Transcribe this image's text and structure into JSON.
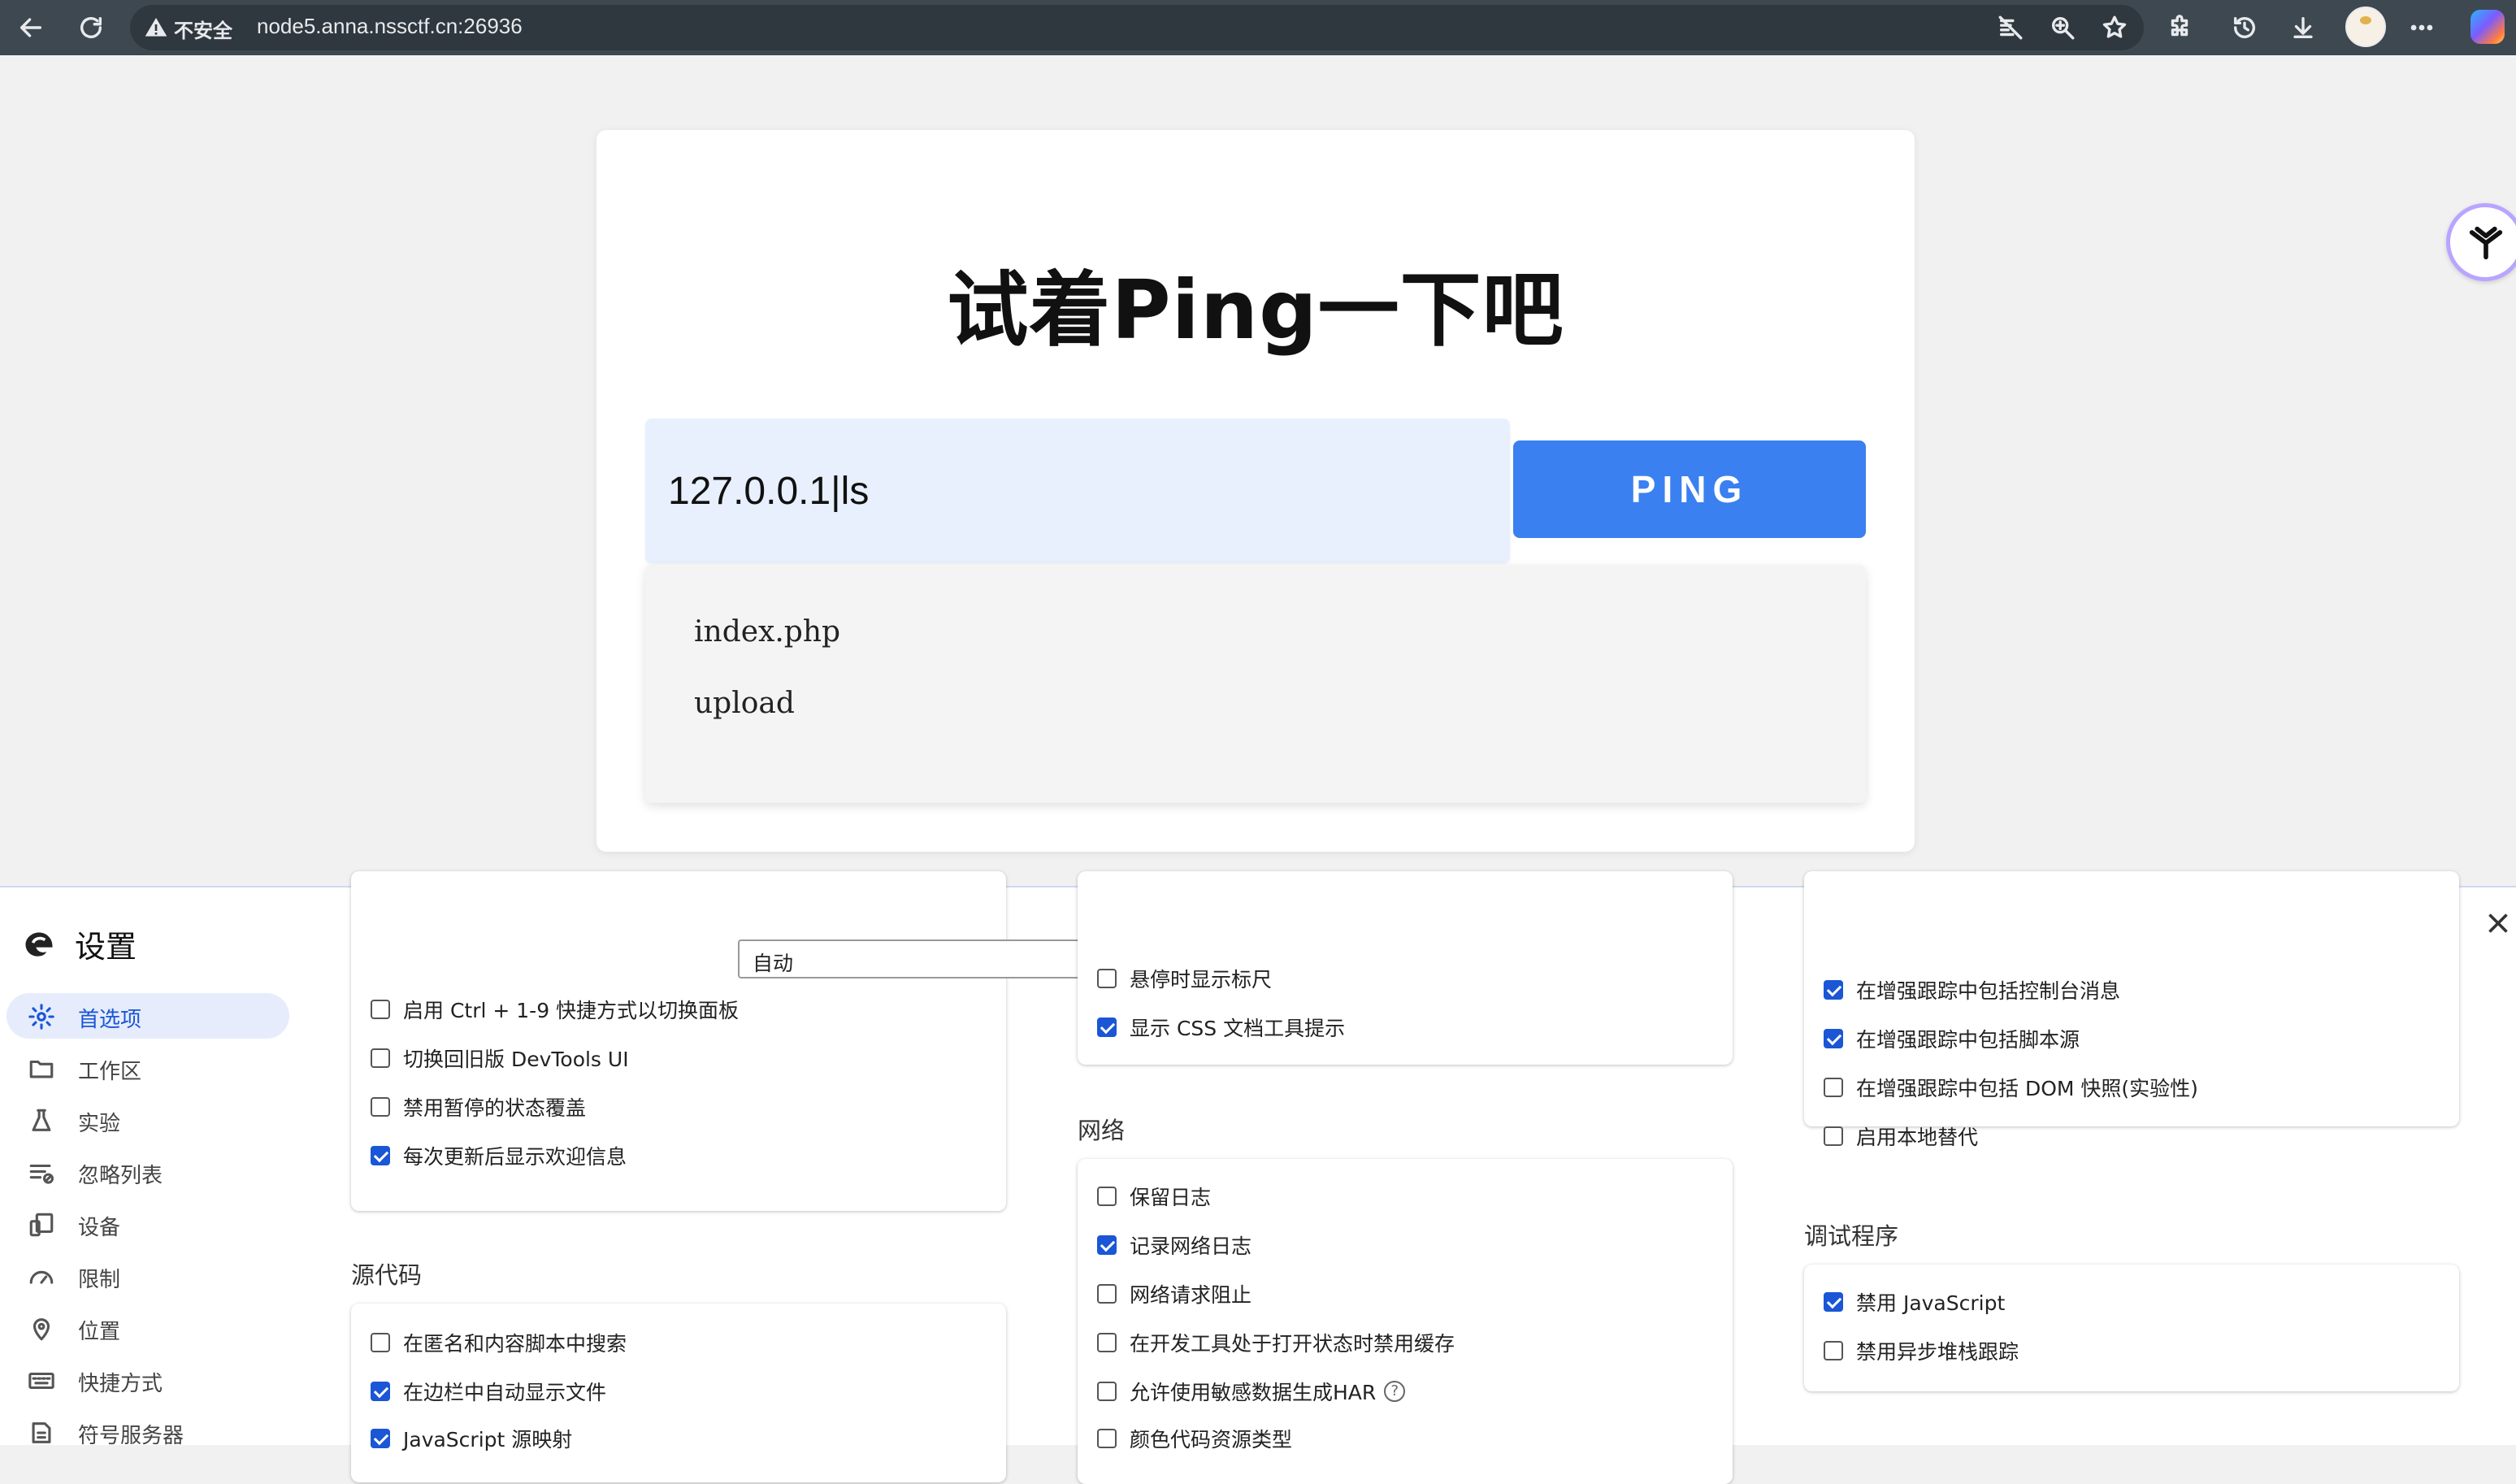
{
  "browser": {
    "security_label": "不安全",
    "url": "node5.anna.nssctf.cn:26936",
    "icons": [
      "back-icon",
      "reload-icon",
      "warning-icon",
      "reading-mode-off-icon",
      "zoom-icon",
      "favorite-star-icon",
      "extensions-icon",
      "history-icon",
      "download-icon",
      "profile-avatar",
      "more-icon",
      "copilot-icon"
    ]
  },
  "page": {
    "title": "试着Ping一下吧",
    "input_value": "127.0.0.1|ls",
    "button_label": "PING",
    "results": [
      "index.php",
      "upload"
    ]
  },
  "devtools": {
    "title": "设置",
    "nav": [
      {
        "label": "首选项",
        "icon": "gear-icon",
        "active": true
      },
      {
        "label": "工作区",
        "icon": "folder-icon",
        "active": false
      },
      {
        "label": "实验",
        "icon": "flask-icon",
        "active": false
      },
      {
        "label": "忽略列表",
        "icon": "ignore-list-icon",
        "active": false
      },
      {
        "label": "设备",
        "icon": "devices-icon",
        "active": false
      },
      {
        "label": "限制",
        "icon": "throttle-icon",
        "active": false
      },
      {
        "label": "位置",
        "icon": "location-pin-icon",
        "active": false
      },
      {
        "label": "快捷方式",
        "icon": "keyboard-icon",
        "active": false
      },
      {
        "label": "符号服务器",
        "icon": "symbol-server-icon",
        "active": false
      }
    ],
    "col1": {
      "select_value": "自动",
      "options": [
        {
          "label": "启用 Ctrl + 1-9 快捷方式以切换面板",
          "checked": false
        },
        {
          "label": "切换回旧版 DevTools UI",
          "checked": false
        },
        {
          "label": "禁用暂停的状态覆盖",
          "checked": false
        },
        {
          "label": "每次更新后显示欢迎信息",
          "checked": true
        }
      ],
      "sources_heading": "源代码",
      "sources_options": [
        {
          "label": "在匿名和内容脚本中搜索",
          "checked": false
        },
        {
          "label": "在边栏中自动显示文件",
          "checked": true
        },
        {
          "label": "JavaScript 源映射",
          "checked": true
        }
      ]
    },
    "col2": {
      "options": [
        {
          "label": "悬停时显示标尺",
          "checked": false
        },
        {
          "label": "显示 CSS 文档工具提示",
          "checked": true
        }
      ],
      "network_heading": "网络",
      "network_options": [
        {
          "label": "保留日志",
          "checked": false
        },
        {
          "label": "记录网络日志",
          "checked": true
        },
        {
          "label": "网络请求阻止",
          "checked": false
        },
        {
          "label": "在开发工具处于打开状态时禁用缓存",
          "checked": false
        },
        {
          "label": "允许使用敏感数据生成HAR",
          "checked": false
        },
        {
          "label": "颜色代码资源类型",
          "checked": false
        }
      ],
      "help_glyph": "?"
    },
    "col3": {
      "options": [
        {
          "label": "在增强跟踪中包括控制台消息",
          "checked": true
        },
        {
          "label": "在增强跟踪中包括脚本源",
          "checked": true
        },
        {
          "label": "在增强跟踪中包括 DOM 快照(实验性)",
          "checked": false
        },
        {
          "label": "启用本地替代",
          "checked": false
        }
      ],
      "debugger_heading": "调试程序",
      "debugger_options": [
        {
          "label": "禁用 JavaScript",
          "checked": true
        },
        {
          "label": "禁用异步堆栈跟踪",
          "checked": false
        }
      ]
    }
  }
}
